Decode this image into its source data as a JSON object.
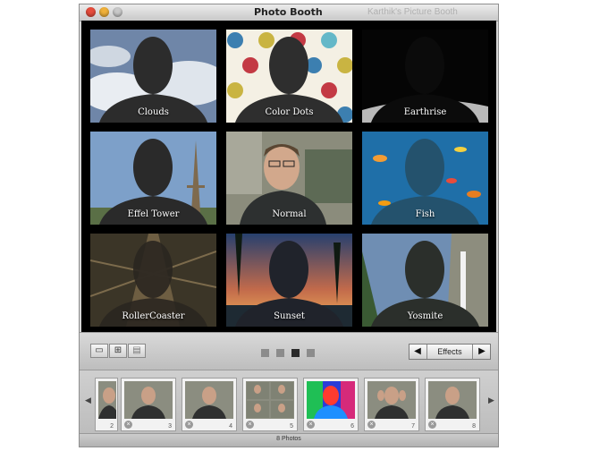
{
  "window": {
    "title": "Photo Booth",
    "ghost_title": "Karthik's Picture Booth"
  },
  "effects": [
    {
      "label": "Clouds",
      "icon": "clouds-effect-icon"
    },
    {
      "label": "Color Dots",
      "icon": "color-dots-effect-icon"
    },
    {
      "label": "Earthrise",
      "icon": "earthrise-effect-icon"
    },
    {
      "label": "Effel Tower",
      "icon": "eiffel-tower-effect-icon"
    },
    {
      "label": "Normal",
      "icon": "normal-effect-icon"
    },
    {
      "label": "Fish",
      "icon": "fish-effect-icon"
    },
    {
      "label": "RollerCoaster",
      "icon": "rollercoaster-effect-icon"
    },
    {
      "label": "Sunset",
      "icon": "sunset-effect-icon"
    },
    {
      "label": "Yosmite",
      "icon": "yosemite-effect-icon"
    }
  ],
  "toolbar": {
    "effects_label": "Effects",
    "prev_icon": "left-arrow-icon",
    "next_icon": "right-arrow-icon",
    "page_count": 4,
    "current_page": 3
  },
  "filmstrip": {
    "thumbnails": [
      {
        "number": "2"
      },
      {
        "number": "3"
      },
      {
        "number": "4"
      },
      {
        "number": "5"
      },
      {
        "number": "6"
      },
      {
        "number": "7"
      },
      {
        "number": "8"
      }
    ]
  },
  "status": {
    "photo_count": "8 Photos"
  }
}
